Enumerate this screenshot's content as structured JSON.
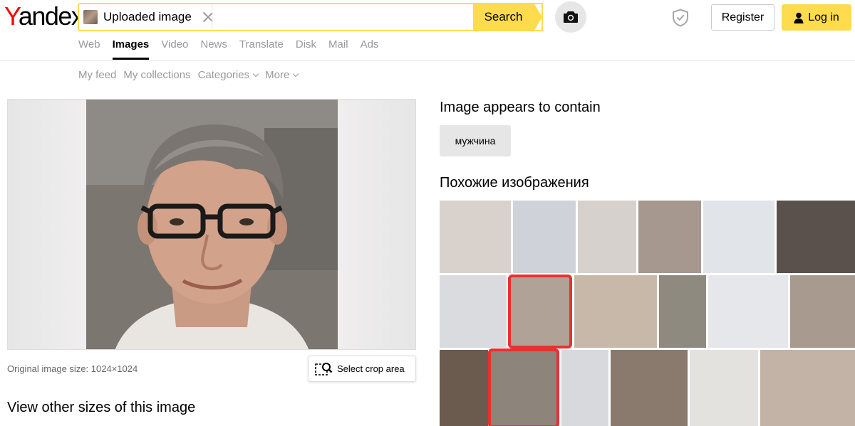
{
  "header": {
    "logo_y": "Y",
    "logo_rest": "andex",
    "search_chip_label": "Uploaded image",
    "search_button": "Search",
    "register": "Register",
    "login": "Log in"
  },
  "tabs": [
    {
      "label": "Web",
      "active": false
    },
    {
      "label": "Images",
      "active": true
    },
    {
      "label": "Video",
      "active": false
    },
    {
      "label": "News",
      "active": false
    },
    {
      "label": "Translate",
      "active": false
    },
    {
      "label": "Disk",
      "active": false
    },
    {
      "label": "Mail",
      "active": false
    },
    {
      "label": "Ads",
      "active": false
    }
  ],
  "subnav": {
    "my_feed": "My feed",
    "my_collections": "My collections",
    "categories": "Categories",
    "more": "More"
  },
  "left": {
    "size_note": "Original image size: 1024×1024",
    "crop_button": "Select crop area",
    "view_sizes": "View other sizes of this image"
  },
  "right": {
    "contains_title": "Image appears to contain",
    "tag": "мужчина",
    "similar_title": "Похожие изображения"
  },
  "colors": {
    "accent": "#ffdb4d",
    "highlight": "#e8312f",
    "tab_inactive": "#999999"
  }
}
